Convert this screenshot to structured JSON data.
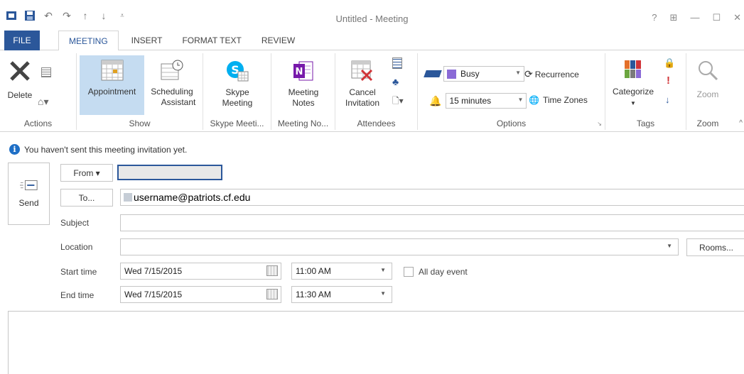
{
  "window": {
    "title": "Untitled - Meeting",
    "controls": [
      "?",
      "⊞",
      "—",
      "☐",
      "✕"
    ]
  },
  "tabs": [
    {
      "label": "FILE",
      "active": false
    },
    {
      "label": "MEETING",
      "active": true
    },
    {
      "label": "INSERT",
      "active": false
    },
    {
      "label": "FORMAT TEXT",
      "active": false
    },
    {
      "label": "REVIEW",
      "active": false
    }
  ],
  "ribbon": {
    "actions": {
      "group": "Actions",
      "delete": "Delete"
    },
    "show": {
      "group": "Show",
      "appointment": "Appointment",
      "scheduling1": "Scheduling",
      "scheduling2": "Assistant"
    },
    "skype": {
      "group": "Skype Meeti...",
      "line1": "Skype",
      "line2": "Meeting"
    },
    "notes": {
      "group": "Meeting No...",
      "line1": "Meeting",
      "line2": "Notes"
    },
    "attendees": {
      "group": "Attendees",
      "line1": "Cancel",
      "line2": "Invitation"
    },
    "options": {
      "group": "Options",
      "busy": "Busy",
      "reminder": "15 minutes",
      "recurrence": "Recurrence",
      "timezones": "Time Zones"
    },
    "tags": {
      "group": "Tags",
      "categorize": "Categorize"
    },
    "zoom": {
      "group": "Zoom",
      "zoom": "Zoom"
    }
  },
  "info_text": "You haven't sent this meeting invitation yet.",
  "form": {
    "send": "Send",
    "from_button": "From ▾",
    "from_value": "",
    "to_button": "To...",
    "to_value": "username@patriots.cf.edu",
    "subject_label": "Subject",
    "subject_value": "",
    "location_label": "Location",
    "location_value": "",
    "rooms_button": "Rooms...",
    "start_label": "Start time",
    "start_date": "Wed 7/15/2015",
    "start_time": "11:00 AM",
    "all_day_label": "All day event",
    "end_label": "End time",
    "end_date": "Wed 7/15/2015",
    "end_time": "11:30 AM"
  },
  "colors": {
    "accent": "#2b579a",
    "selected": "#c5dcf1",
    "busy": "#8a6ad6"
  }
}
